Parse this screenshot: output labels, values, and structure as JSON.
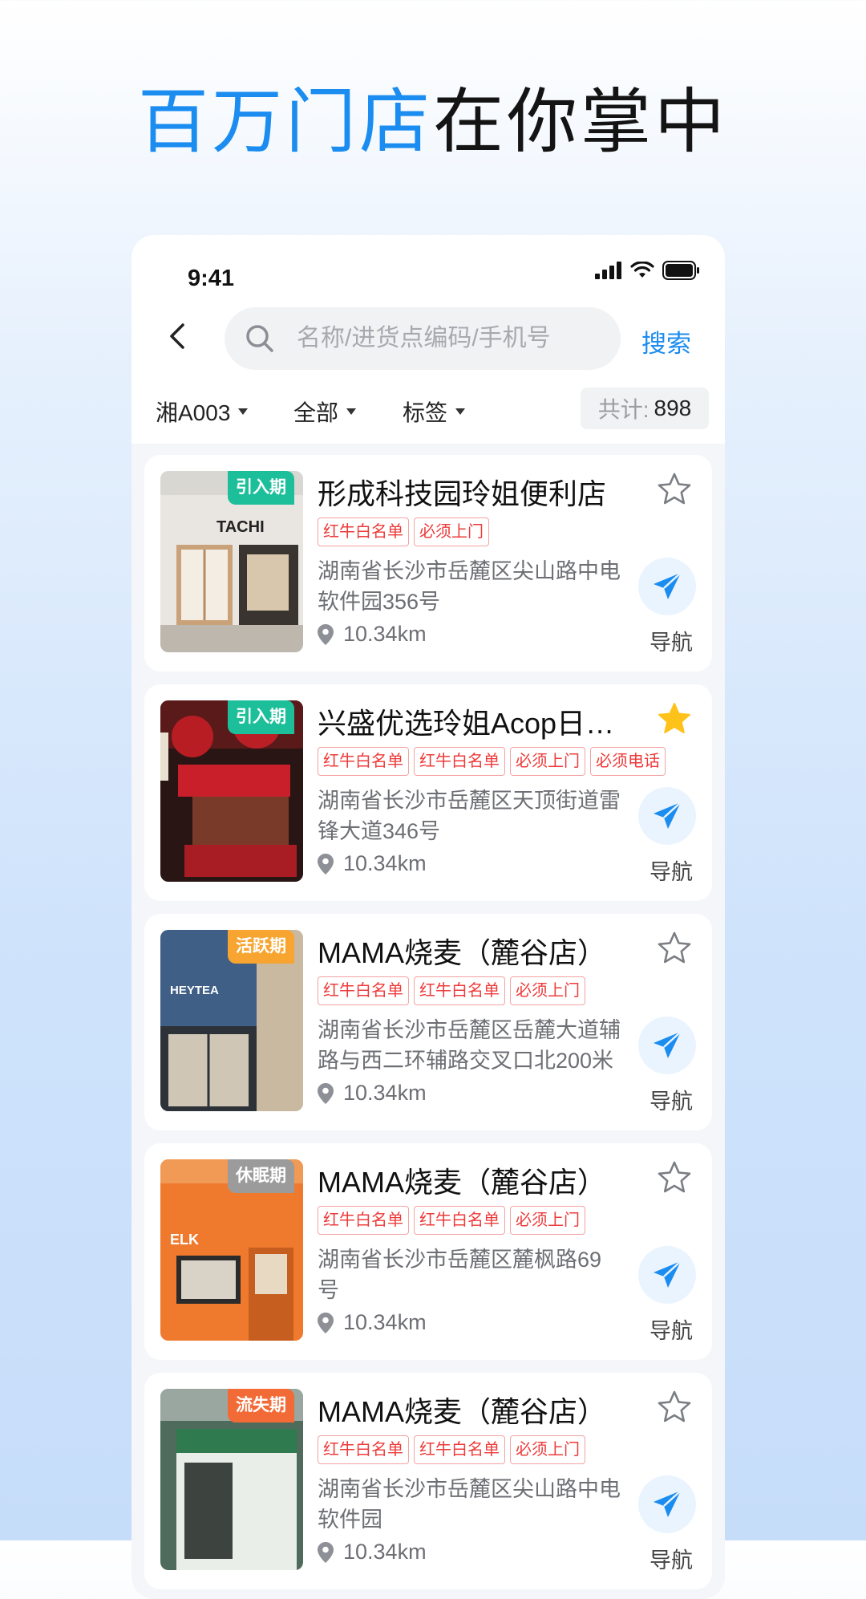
{
  "headline": {
    "blue_part": "百万门店",
    "black_part": "在你掌中"
  },
  "status_bar": {
    "time": "9:41"
  },
  "search": {
    "placeholder": "名称/进货点编码/手机号",
    "button_label": "搜索"
  },
  "filters": [
    {
      "label": "湘A003"
    },
    {
      "label": "全部"
    },
    {
      "label": "标签"
    }
  ],
  "total": {
    "label": "共计:",
    "value": "898"
  },
  "colors": {
    "accent": "#1b8cf0",
    "tag_red": "#ee3b3b",
    "stage_intro": "#1dbf9a",
    "stage_active": "#f7a530",
    "stage_dormant": "#9b9b9b",
    "stage_lost": "#f26a36",
    "star_filled": "#ffc21a"
  },
  "stores": [
    {
      "stage": "引入期",
      "name": "形成科技园玲姐便利店",
      "tags": [
        "红牛白名单",
        "必须上门"
      ],
      "address": "湖南省长沙市岳麓区尖山路中电软件园356号",
      "distance": "10.34km",
      "favorited": false,
      "nav_label": "导航"
    },
    {
      "stage": "引入期",
      "name": "兴盛优选玲姐Acop日咖啡便利店",
      "tags": [
        "红牛白名单",
        "红牛白名单",
        "必须上门",
        "必须电话"
      ],
      "address": "湖南省长沙市岳麓区天顶街道雷锋大道346号",
      "distance": "10.34km",
      "favorited": true,
      "nav_label": "导航"
    },
    {
      "stage": "活跃期",
      "name": "MAMA烧麦（麓谷店）",
      "tags": [
        "红牛白名单",
        "红牛白名单",
        "必须上门"
      ],
      "address": "湖南省长沙市岳麓区岳麓大道辅路与西二环辅路交叉口北200米",
      "distance": "10.34km",
      "favorited": false,
      "nav_label": "导航"
    },
    {
      "stage": "休眠期",
      "name": "MAMA烧麦（麓谷店）",
      "tags": [
        "红牛白名单",
        "红牛白名单",
        "必须上门"
      ],
      "address": "湖南省长沙市岳麓区麓枫路69号",
      "distance": "10.34km",
      "favorited": false,
      "nav_label": "导航"
    },
    {
      "stage": "流失期",
      "name": "MAMA烧麦（麓谷店）",
      "tags": [
        "红牛白名单",
        "红牛白名单",
        "必须上门"
      ],
      "address": "湖南省长沙市岳麓区尖山路中电软件园",
      "distance": "10.34km",
      "favorited": false,
      "nav_label": "导航"
    }
  ]
}
